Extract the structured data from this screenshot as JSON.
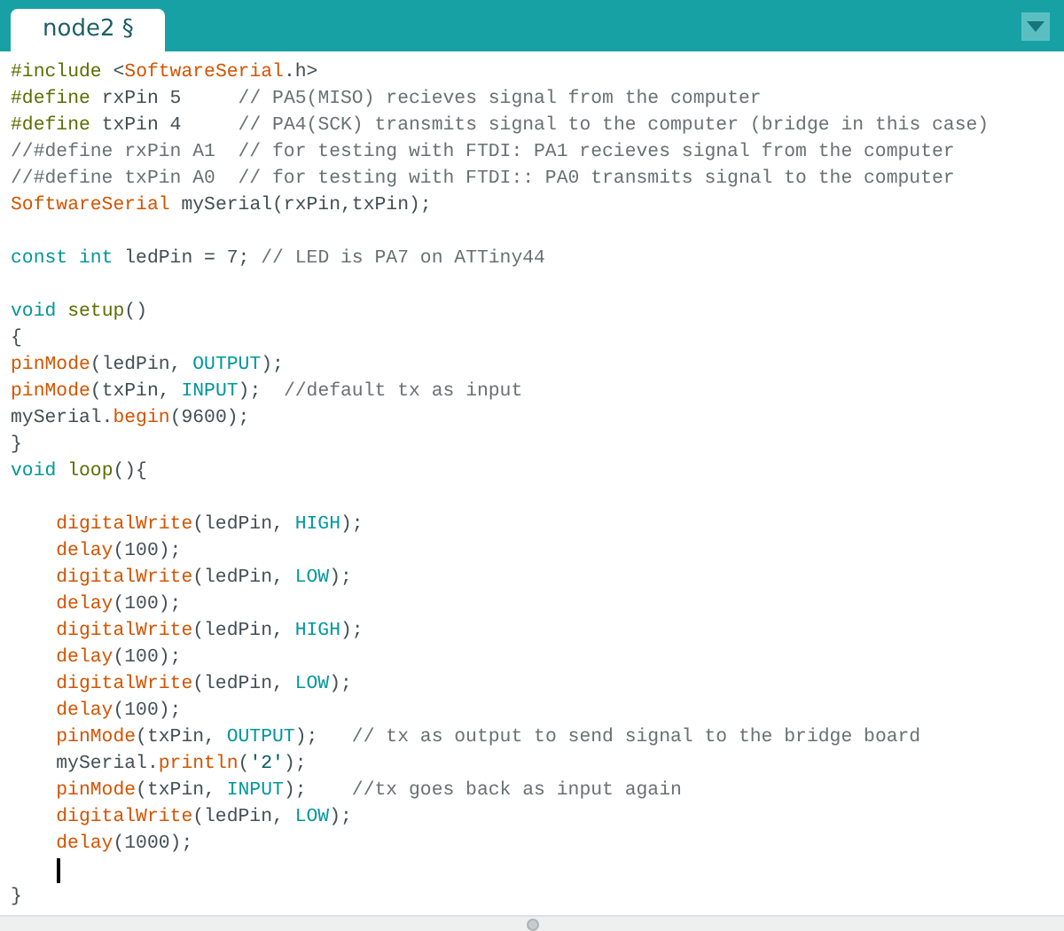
{
  "tabs": [
    {
      "label": "node2 §",
      "selected": true
    }
  ],
  "editor": {
    "lines": [
      {
        "kind": "code",
        "segments": [
          {
            "kind": "directive",
            "text": "#include "
          },
          {
            "kind": "plain",
            "text": "<"
          },
          {
            "kind": "function",
            "text": "SoftwareSerial"
          },
          {
            "kind": "plain",
            "text": ".h>"
          }
        ]
      },
      {
        "kind": "code",
        "segments": [
          {
            "kind": "directive",
            "text": "#define"
          },
          {
            "kind": "plain",
            "text": " rxPin 5     "
          },
          {
            "kind": "comment",
            "text": "// PA5(MISO) recieves signal from the computer"
          }
        ]
      },
      {
        "kind": "code",
        "segments": [
          {
            "kind": "directive",
            "text": "#define"
          },
          {
            "kind": "plain",
            "text": " txPin 4     "
          },
          {
            "kind": "comment",
            "text": "// PA4(SCK) transmits signal to the computer (bridge in this case)"
          }
        ]
      },
      {
        "kind": "code",
        "segments": [
          {
            "kind": "comment",
            "text": "//#define rxPin A1  // for testing with FTDI: PA1 recieves signal from the computer"
          }
        ]
      },
      {
        "kind": "code",
        "segments": [
          {
            "kind": "comment",
            "text": "//#define txPin A0  // for testing with FTDI:: PA0 transmits signal to the computer"
          }
        ]
      },
      {
        "kind": "code",
        "segments": [
          {
            "kind": "function",
            "text": "SoftwareSerial"
          },
          {
            "kind": "plain",
            "text": " mySerial(rxPin,txPin);"
          }
        ]
      },
      {
        "kind": "blank"
      },
      {
        "kind": "code",
        "segments": [
          {
            "kind": "keyword",
            "text": "const int"
          },
          {
            "kind": "plain",
            "text": " ledPin = 7; "
          },
          {
            "kind": "comment",
            "text": "// LED is PA7 on ATTiny44"
          }
        ]
      },
      {
        "kind": "blank"
      },
      {
        "kind": "code",
        "segments": [
          {
            "kind": "keyword",
            "text": "void "
          },
          {
            "kind": "directive",
            "text": "setup"
          },
          {
            "kind": "plain",
            "text": "()"
          }
        ]
      },
      {
        "kind": "code",
        "segments": [
          {
            "kind": "plain",
            "text": "{"
          }
        ]
      },
      {
        "kind": "code",
        "segments": [
          {
            "kind": "function",
            "text": "pinMode"
          },
          {
            "kind": "plain",
            "text": "(ledPin, "
          },
          {
            "kind": "keyword",
            "text": "OUTPUT"
          },
          {
            "kind": "plain",
            "text": ");"
          }
        ]
      },
      {
        "kind": "code",
        "segments": [
          {
            "kind": "function",
            "text": "pinMode"
          },
          {
            "kind": "plain",
            "text": "(txPin, "
          },
          {
            "kind": "keyword",
            "text": "INPUT"
          },
          {
            "kind": "plain",
            "text": ");  "
          },
          {
            "kind": "comment",
            "text": "//default tx as input"
          }
        ]
      },
      {
        "kind": "code",
        "segments": [
          {
            "kind": "plain",
            "text": "mySerial."
          },
          {
            "kind": "function",
            "text": "begin"
          },
          {
            "kind": "plain",
            "text": "(9600);"
          }
        ]
      },
      {
        "kind": "code",
        "segments": [
          {
            "kind": "plain",
            "text": "}"
          }
        ]
      },
      {
        "kind": "code",
        "segments": [
          {
            "kind": "keyword",
            "text": "void "
          },
          {
            "kind": "directive",
            "text": "loop"
          },
          {
            "kind": "plain",
            "text": "(){"
          }
        ]
      },
      {
        "kind": "blank"
      },
      {
        "kind": "code",
        "indent": true,
        "segments": [
          {
            "kind": "function",
            "text": "digitalWrite"
          },
          {
            "kind": "plain",
            "text": "(ledPin, "
          },
          {
            "kind": "keyword",
            "text": "HIGH"
          },
          {
            "kind": "plain",
            "text": ");"
          }
        ]
      },
      {
        "kind": "code",
        "indent": true,
        "segments": [
          {
            "kind": "function",
            "text": "delay"
          },
          {
            "kind": "plain",
            "text": "(100);"
          }
        ]
      },
      {
        "kind": "code",
        "indent": true,
        "segments": [
          {
            "kind": "function",
            "text": "digitalWrite"
          },
          {
            "kind": "plain",
            "text": "(ledPin, "
          },
          {
            "kind": "keyword",
            "text": "LOW"
          },
          {
            "kind": "plain",
            "text": ");"
          }
        ]
      },
      {
        "kind": "code",
        "indent": true,
        "segments": [
          {
            "kind": "function",
            "text": "delay"
          },
          {
            "kind": "plain",
            "text": "(100);"
          }
        ]
      },
      {
        "kind": "code",
        "indent": true,
        "segments": [
          {
            "kind": "function",
            "text": "digitalWrite"
          },
          {
            "kind": "plain",
            "text": "(ledPin, "
          },
          {
            "kind": "keyword",
            "text": "HIGH"
          },
          {
            "kind": "plain",
            "text": ");"
          }
        ]
      },
      {
        "kind": "code",
        "indent": true,
        "segments": [
          {
            "kind": "function",
            "text": "delay"
          },
          {
            "kind": "plain",
            "text": "(100);"
          }
        ]
      },
      {
        "kind": "code",
        "indent": true,
        "segments": [
          {
            "kind": "function",
            "text": "digitalWrite"
          },
          {
            "kind": "plain",
            "text": "(ledPin, "
          },
          {
            "kind": "keyword",
            "text": "LOW"
          },
          {
            "kind": "plain",
            "text": ");"
          }
        ]
      },
      {
        "kind": "code",
        "indent": true,
        "segments": [
          {
            "kind": "function",
            "text": "delay"
          },
          {
            "kind": "plain",
            "text": "(100);"
          }
        ]
      },
      {
        "kind": "code",
        "indent": true,
        "segments": [
          {
            "kind": "function",
            "text": "pinMode"
          },
          {
            "kind": "plain",
            "text": "(txPin, "
          },
          {
            "kind": "keyword",
            "text": "OUTPUT"
          },
          {
            "kind": "plain",
            "text": ");   "
          },
          {
            "kind": "comment",
            "text": "// tx as output to send signal to the bridge board"
          }
        ]
      },
      {
        "kind": "code",
        "indent": true,
        "segments": [
          {
            "kind": "plain",
            "text": "mySerial."
          },
          {
            "kind": "function",
            "text": "println"
          },
          {
            "kind": "plain",
            "text": "("
          },
          {
            "kind": "string",
            "text": "'2'"
          },
          {
            "kind": "plain",
            "text": ");"
          }
        ]
      },
      {
        "kind": "code",
        "indent": true,
        "segments": [
          {
            "kind": "function",
            "text": "pinMode"
          },
          {
            "kind": "plain",
            "text": "(txPin, "
          },
          {
            "kind": "keyword",
            "text": "INPUT"
          },
          {
            "kind": "plain",
            "text": ");    "
          },
          {
            "kind": "comment",
            "text": "//tx goes back as input again"
          }
        ]
      },
      {
        "kind": "code",
        "indent": true,
        "segments": [
          {
            "kind": "function",
            "text": "digitalWrite"
          },
          {
            "kind": "plain",
            "text": "(ledPin, "
          },
          {
            "kind": "keyword",
            "text": "LOW"
          },
          {
            "kind": "plain",
            "text": ");"
          }
        ]
      },
      {
        "kind": "code",
        "indent": true,
        "segments": [
          {
            "kind": "function",
            "text": "delay"
          },
          {
            "kind": "plain",
            "text": "(1000);"
          }
        ]
      },
      {
        "kind": "cursor"
      },
      {
        "kind": "code",
        "segments": [
          {
            "kind": "plain",
            "text": "}"
          }
        ]
      }
    ]
  }
}
